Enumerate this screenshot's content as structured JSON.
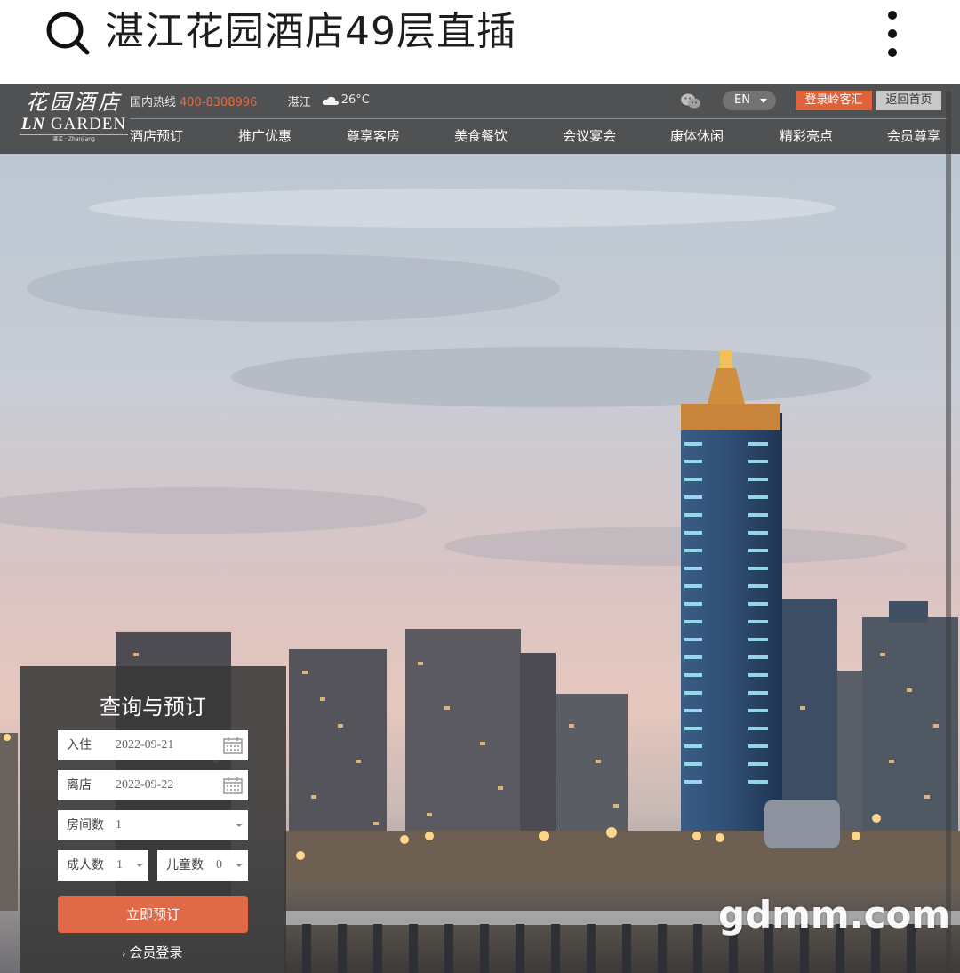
{
  "search": {
    "query": "湛江花园酒店49层直插",
    "icon": "search-icon",
    "menu_icon": "more-vertical-icon"
  },
  "site": {
    "logo": {
      "cn": "花园酒店",
      "en_prefix": "LN",
      "en_name": "GARDEN",
      "city": "湛江 · Zhanjiang"
    },
    "hotline_label": "国内热线",
    "hotline_number": "400-8308996",
    "city": "湛江",
    "weather_icon": "cloud-icon",
    "temperature": "26°C",
    "wechat_icon": "wechat-icon",
    "language": "EN",
    "login_button": "登录岭客汇",
    "home_button": "返回首页",
    "nav": [
      "酒店预订",
      "推广优惠",
      "尊享客房",
      "美食餐饮",
      "会议宴会",
      "康体休闲",
      "精彩亮点",
      "会员尊享"
    ],
    "colors": {
      "accent": "#e0623a",
      "hotline": "#e86b40",
      "header_bg": "#484848"
    }
  },
  "booking": {
    "title": "查询与预订",
    "checkin_label": "入住",
    "checkin_value": "2022-09-21",
    "checkout_label": "离店",
    "checkout_value": "2022-09-22",
    "rooms_label": "房间数",
    "rooms_value": "1",
    "adults_label": "成人数",
    "adults_value": "1",
    "children_label": "儿童数",
    "children_value": "0",
    "book_button": "立即预订",
    "member_login": "会员登录"
  },
  "watermark": "gdmm.com"
}
